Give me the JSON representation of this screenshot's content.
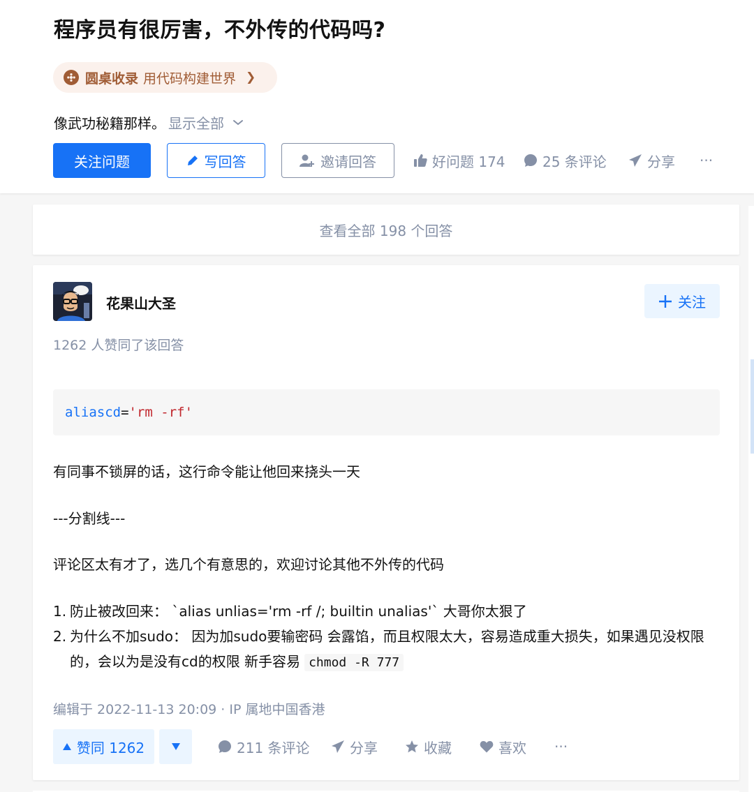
{
  "question": {
    "title": "程序员有很厉害，不外传的代码吗?",
    "roundtable": {
      "name": "圆桌收录",
      "topic": "用代码构建世界",
      "arrow": "❯"
    },
    "detail": "像武功秘籍那样。",
    "show_all": "显示全部"
  },
  "actions": {
    "follow": "关注问题",
    "write": "写回答",
    "invite": "邀请回答",
    "good_question": "好问题 174",
    "comments": "25 条评论",
    "share": "分享",
    "more": "···"
  },
  "view_all": "查看全部 198 个回答",
  "answer": {
    "author": "花果山大圣",
    "follow_label": "关注",
    "voters": "1262 人赞同了该回答",
    "code": {
      "kw": "alias",
      "name": "cd",
      "eq": "=",
      "str": "'rm -rf'"
    },
    "para1": "有同事不锁屏的话，这行命令能让他回来挠头一天",
    "divider": "---分割线---",
    "para2": "评论区太有才了，选几个有意思的，欢迎讨论其他不外传的代码",
    "list": [
      {
        "num": "1.",
        "text": "防止被改回来：  `alias unlias='rm -rf /; builtin unalias'` 大哥你太狠了"
      },
      {
        "num": "2.",
        "text": "为什么不加sudo：  因为加sudo要输密码 会露馅，而且权限太大，容易造成重大损失，如果遇见没权限的，会以为是没有cd的权限 新手容易",
        "code": "chmod -R 777"
      }
    ],
    "edited": "编辑于 2022-11-13 20:09 · IP 属地中国香港",
    "vote_up": "赞同 1262",
    "comments": "211 条评论",
    "share": "分享",
    "collect": "收藏",
    "like": "喜欢",
    "more": "···"
  },
  "colors": {
    "accent": "#1772f6",
    "muted": "#8590a6",
    "roundtable": "#a05c35"
  }
}
